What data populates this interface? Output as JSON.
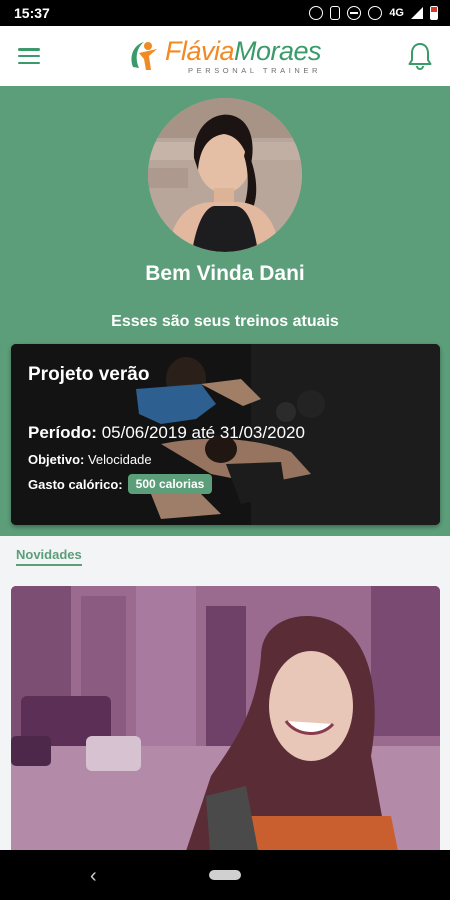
{
  "status_bar": {
    "time": "15:37",
    "network": "4G"
  },
  "app_bar": {
    "logo_first": "Flávia",
    "logo_last": "Moraes",
    "logo_subtitle": "PERSONAL TRAINER",
    "brand_green": "#5c9e79",
    "brand_orange": "#f08a24"
  },
  "hero": {
    "welcome": "Bem Vinda Dani",
    "subtitle": "Esses são seus treinos atuais"
  },
  "workout_card": {
    "title": "Projeto verão",
    "period_label": "Período:",
    "period_value": "05/06/2019 até 31/03/2020",
    "goal_label": "Objetivo:",
    "goal_value": "Velocidade",
    "calories_label": "Gasto calórico:",
    "calories_value": "500 calorias"
  },
  "news": {
    "title": "Novidades"
  },
  "nav": {
    "back_icon": "‹"
  }
}
